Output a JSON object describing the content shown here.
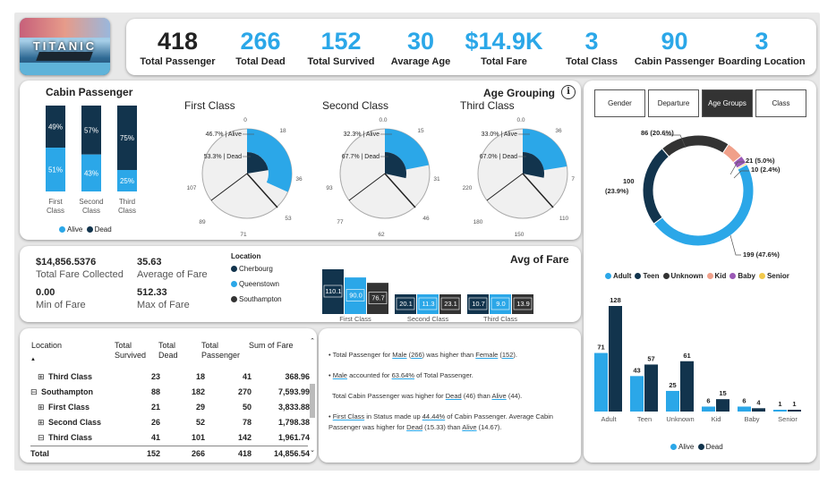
{
  "logo": {
    "text": "TITANIC"
  },
  "kpis": [
    {
      "value": "418",
      "label": "Total Passenger",
      "color": "#222222"
    },
    {
      "value": "266",
      "label": "Total Dead",
      "color": "#2ba7e8"
    },
    {
      "value": "152",
      "label": "Total Survived",
      "color": "#2ba7e8"
    },
    {
      "value": "30",
      "label": "Avarage Age",
      "color": "#2ba7e8"
    },
    {
      "value": "$14.9K",
      "label": "Total Fare",
      "color": "#2ba7e8"
    },
    {
      "value": "3",
      "label": "Total Class",
      "color": "#2ba7e8"
    },
    {
      "value": "90",
      "label": "Cabin Passenger",
      "color": "#2ba7e8"
    },
    {
      "value": "3",
      "label": "Boarding Location",
      "color": "#2ba7e8"
    }
  ],
  "colors": {
    "alive": "#2ba7e8",
    "dead": "#12344d",
    "dark3": "#333333",
    "kid": "#f0a08a",
    "baby": "#9b59b6",
    "senior": "#f2c94c"
  },
  "cabin": {
    "title": "Cabin Passenger",
    "bars": [
      {
        "label": "First Class",
        "dead_pct": 49,
        "alive_pct": 51,
        "dead": "49%",
        "alive": "51%"
      },
      {
        "label": "Second Class",
        "dead_pct": 57,
        "alive_pct": 43,
        "dead": "57%",
        "alive": "43%"
      },
      {
        "label": "Third Class",
        "dead_pct": 75,
        "alive_pct": 25,
        "dead": "75%",
        "alive": "25%"
      }
    ],
    "legend_alive": "Alive",
    "legend_dead": "Dead"
  },
  "age_grouping": {
    "title": "Age Grouping",
    "info_icon": "info-icon",
    "gauges": [
      {
        "title": "First Class",
        "alive": "46.7% | Alive",
        "dead": "53.3% | Dead",
        "alive_frac": 0.467,
        "dead_frac": 0.533,
        "ticks": [
          "0",
          "18",
          "36",
          "53",
          "71",
          "89",
          "107"
        ]
      },
      {
        "title": "Second Class",
        "alive": "32.3% | Alive",
        "dead": "67.7% | Dead",
        "alive_frac": 0.323,
        "dead_frac": 0.677,
        "ticks": [
          "0.0",
          "15",
          "31",
          "46",
          "62",
          "77",
          "93"
        ]
      },
      {
        "title": "Third Class",
        "alive": "33.0% | Alive",
        "dead": "67.0% | Dead",
        "alive_frac": 0.33,
        "dead_frac": 0.67,
        "ticks": [
          "0.0",
          "36",
          "73",
          "110",
          "150",
          "180",
          "220"
        ]
      }
    ]
  },
  "fare_stats": {
    "total_value": "$14,856.5376",
    "total_label": "Total Fare Collected",
    "avg_value": "35.63",
    "avg_label": "Average of Fare",
    "min_value": "0.00",
    "min_label": "Min of Fare",
    "max_value": "512.33",
    "max_label": "Max of Fare"
  },
  "location_legend": {
    "title": "Location",
    "items": [
      "Cherbourg",
      "Queenstown",
      "Southampton"
    ]
  },
  "avg_fare": {
    "title": "Avg of Fare",
    "groups": [
      {
        "label": "First Class",
        "values": [
          110.1,
          90.0,
          76.7
        ],
        "labels": [
          "110.1",
          "90.0",
          "76.7"
        ]
      },
      {
        "label": "Second Class",
        "values": [
          20.1,
          11.3,
          23.1
        ],
        "labels": [
          "20.1",
          "11.3",
          "23.1"
        ]
      },
      {
        "label": "Third Class",
        "values": [
          10.7,
          9.0,
          13.9
        ],
        "labels": [
          "10.7",
          "9.0",
          "13.9"
        ]
      }
    ]
  },
  "table": {
    "headers": [
      "Location",
      "Total Survived",
      "Total Dead",
      "Total Passenger",
      "Sum of Fare"
    ],
    "rows": [
      {
        "expander": "⊞",
        "name": "Third Class",
        "indent": 1,
        "bold": true,
        "cells": [
          "23",
          "18",
          "41",
          "368.96"
        ]
      },
      {
        "expander": "⊟",
        "name": "Southampton",
        "indent": 0,
        "bold": true,
        "cells": [
          "88",
          "182",
          "270",
          "7,593.99"
        ]
      },
      {
        "expander": "⊞",
        "name": "First Class",
        "indent": 1,
        "bold": true,
        "cells": [
          "21",
          "29",
          "50",
          "3,833.88"
        ]
      },
      {
        "expander": "⊞",
        "name": "Second Class",
        "indent": 1,
        "bold": true,
        "cells": [
          "26",
          "52",
          "78",
          "1,798.38"
        ]
      },
      {
        "expander": "⊟",
        "name": "Third Class",
        "indent": 1,
        "bold": true,
        "cells": [
          "41",
          "101",
          "142",
          "1,961.74"
        ]
      },
      {
        "expander": "",
        "name": "Total",
        "indent": 0,
        "bold": true,
        "cells": [
          "152",
          "266",
          "418",
          "14,856.54"
        ]
      }
    ]
  },
  "insights": {
    "i1": {
      "a": "Total Passenger for ",
      "b": "Male",
      "c": " (",
      "d": "266",
      "e": ") was higher than ",
      "f": "Female",
      "g": " (",
      "h": "152",
      "i": ")."
    },
    "i2": {
      "a": "Male",
      "b": " accounted for ",
      "c": "63.64%",
      "d": " of Total Passenger."
    },
    "i3": {
      "a": "Total Cabin Passenger was higher for ",
      "b": "Dead",
      "c": " (46) than ",
      "d": "Alive",
      "e": " (44)."
    },
    "i4": {
      "a": "First Class",
      "b": " in Status  made up ",
      "c": "44.44%",
      "d": " of Cabin Passenger. Average Cabin Passenger was higher for ",
      "e": "Dead",
      "f": " (15.33) than ",
      "g": "Alive",
      "h": " (14.67)."
    }
  },
  "tabs": [
    {
      "label": "Gender",
      "active": false
    },
    {
      "label": "Departure",
      "active": false
    },
    {
      "label": "Age Groups",
      "active": true
    },
    {
      "label": "Class",
      "active": false
    }
  ],
  "donut": {
    "slices": [
      {
        "name": "Adult",
        "value": 199,
        "label": "199 (47.6%)",
        "color": "#2ba7e8"
      },
      {
        "name": "Teen",
        "value": 100,
        "label": "100 (23.9%)",
        "color": "#12344d"
      },
      {
        "name": "Unknown",
        "value": 86,
        "label": "86 (20.6%)",
        "color": "#333333"
      },
      {
        "name": "Kid",
        "value": 21,
        "label": "21 (5.0%)",
        "color": "#f0a08a"
      },
      {
        "name": "Baby",
        "value": 10,
        "label": "10 (2.4%)",
        "color": "#9b59b6"
      },
      {
        "name": "Senior",
        "value": 2,
        "label": "",
        "color": "#f2c94c"
      }
    ],
    "legend": [
      "Adult",
      "Teen",
      "Unknown",
      "Kid",
      "Baby",
      "Senior"
    ]
  },
  "chart_data": [
    {
      "type": "bar",
      "title": "Age Groups",
      "categories": [
        "Adult",
        "Teen",
        "Unknown",
        "Kid",
        "Baby",
        "Senior"
      ],
      "series": [
        {
          "name": "Alive",
          "values": [
            71,
            43,
            25,
            6,
            6,
            1
          ]
        },
        {
          "name": "Dead",
          "values": [
            128,
            57,
            61,
            15,
            4,
            1
          ]
        }
      ],
      "ylim": [
        0,
        140
      ]
    },
    {
      "type": "pie",
      "title": "",
      "categories": [
        "Adult",
        "Teen",
        "Unknown",
        "Kid",
        "Baby",
        "Senior"
      ],
      "values": [
        199,
        100,
        86,
        21,
        10,
        2
      ]
    },
    {
      "type": "bar",
      "title": "Avg of Fare",
      "categories": [
        "First Class",
        "Second Class",
        "Third Class"
      ],
      "series": [
        {
          "name": "Cherbourg",
          "values": [
            110.1,
            20.1,
            10.7
          ]
        },
        {
          "name": "Queenstown",
          "values": [
            90.0,
            11.3,
            9.0
          ]
        },
        {
          "name": "Southampton",
          "values": [
            76.7,
            23.1,
            13.9
          ]
        }
      ]
    }
  ],
  "bar_legend": {
    "alive": "Alive",
    "dead": "Dead"
  }
}
